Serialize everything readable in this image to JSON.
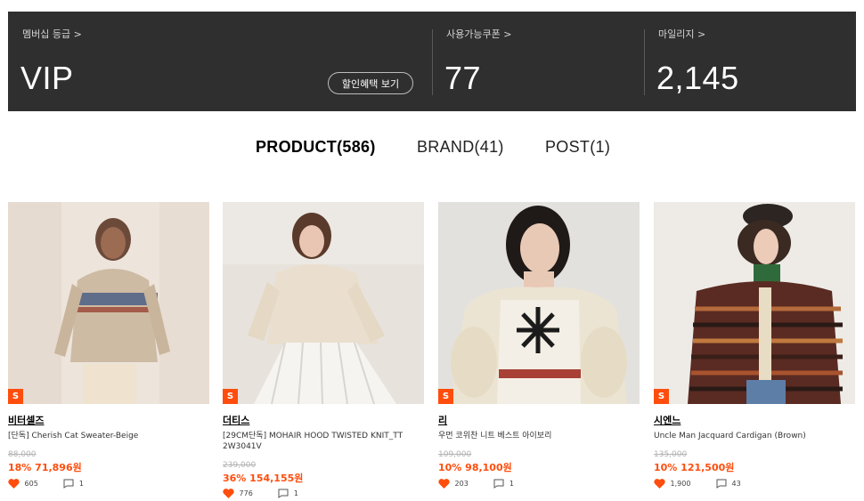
{
  "membership": {
    "grade_label": "멤버십 등급 >",
    "grade_value": "VIP",
    "benefit_button": "할인혜택 보기",
    "coupon_label": "사용가능쿠폰 >",
    "coupon_value": "77",
    "mileage_label": "마일리지 >",
    "mileage_value": "2,145"
  },
  "tabs": [
    {
      "label": "PRODUCT(586)",
      "active": true
    },
    {
      "label": "BRAND(41)",
      "active": false
    },
    {
      "label": "POST(1)",
      "active": false
    }
  ],
  "colors": {
    "accent": "#ff4d0d",
    "header_bg": "#2f2f2f"
  },
  "products": [
    {
      "badge": "S",
      "brand": "비터셀즈",
      "name": "[단독] Cherish Cat Sweater-Beige",
      "original_price": "88,000",
      "sale": "18% 71,896원",
      "likes": "605",
      "comments": "1",
      "image_icon": "product-photo"
    },
    {
      "badge": "S",
      "brand": "더티스",
      "name": "[29CM단독] MOHAIR HOOD TWISTED KNIT_TT 2W3041V",
      "original_price": "239,000",
      "sale": "36% 154,155원",
      "likes": "776",
      "comments": "1",
      "image_icon": "product-photo"
    },
    {
      "badge": "S",
      "brand": "리",
      "name": "우먼 코위찬 니트 베스트 아이보리",
      "original_price": "109,000",
      "sale": "10% 98,100원",
      "likes": "203",
      "comments": "1",
      "image_icon": "product-photo"
    },
    {
      "badge": "S",
      "brand": "시엔느",
      "name": "Uncle Man Jacquard Cardigan (Brown)",
      "original_price": "135,000",
      "sale": "10% 121,500원",
      "likes": "1,900",
      "comments": "43",
      "image_icon": "product-photo"
    }
  ]
}
